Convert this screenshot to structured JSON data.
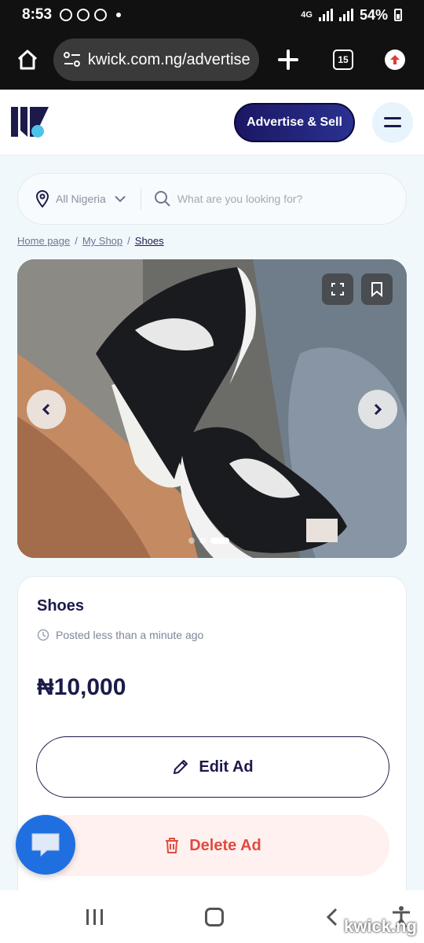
{
  "status_bar": {
    "time": "8:53",
    "network": "4G",
    "battery": "54%"
  },
  "browser": {
    "url": "kwick.com.ng/advertise",
    "tab_count": "15"
  },
  "header": {
    "advertise_label": "Advertise & Sell"
  },
  "search": {
    "location": "All Nigeria",
    "placeholder": "What are you looking for?"
  },
  "breadcrumb": {
    "home": "Home page",
    "shop": "My Shop",
    "current": "Shoes",
    "separator": "/"
  },
  "gallery": {
    "image_count": 3,
    "active_index": 2
  },
  "listing": {
    "title": "Shoes",
    "posted": "Posted less than a minute ago",
    "price": "₦10,000",
    "edit_label": "Edit Ad",
    "delete_label": "Delete Ad"
  },
  "watermark": "kwick.ng",
  "colors": {
    "brand_navy": "#1b1a4a",
    "accent_blue": "#1f6fe0",
    "delete_red": "#e24a3f"
  }
}
